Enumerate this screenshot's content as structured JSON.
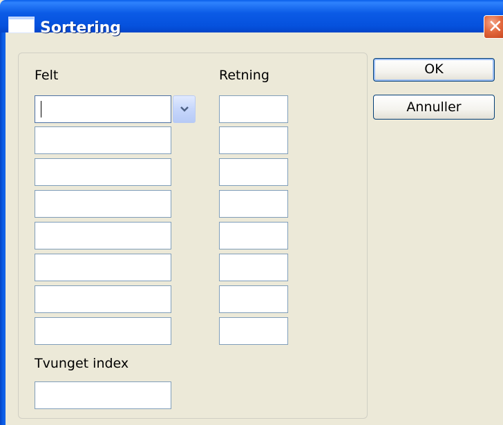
{
  "window": {
    "title": "Sortering",
    "close_symbol": "✕"
  },
  "icons": {
    "title": "window-icon",
    "close": "close-icon",
    "dropdown": "chevron-down-icon"
  },
  "colors": {
    "titlebar": "#0A5FEA",
    "close_button": "#E2683D",
    "background": "#ECE9D8",
    "field_border": "#7F9DB9"
  },
  "form": {
    "felt_label": "Felt",
    "retning_label": "Retning",
    "tvunget_label": "Tvunget index",
    "felt_values": [
      "",
      "",
      "",
      "",
      "",
      "",
      "",
      ""
    ],
    "retning_values": [
      "",
      "",
      "",
      "",
      "",
      "",
      "",
      ""
    ],
    "tvunget_value": ""
  },
  "buttons": {
    "ok_label": "OK",
    "cancel_label": "Annuller"
  }
}
